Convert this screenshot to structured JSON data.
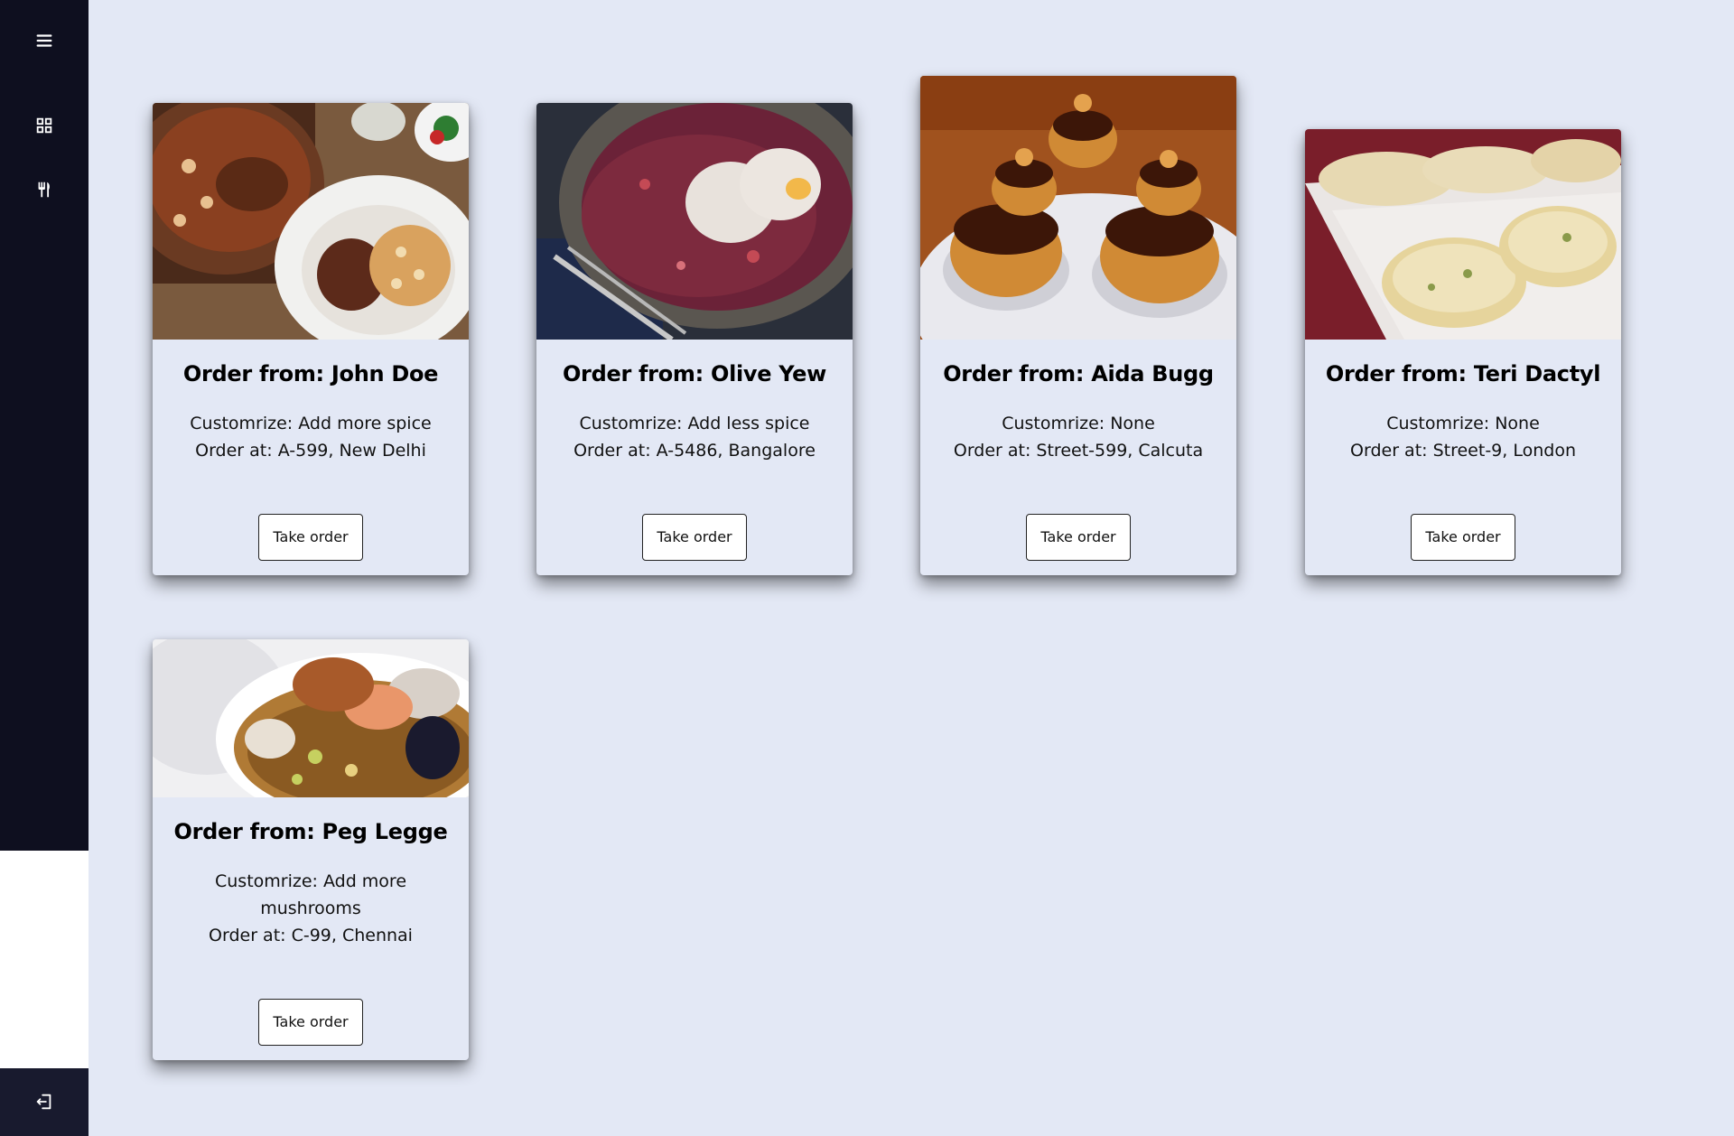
{
  "sidebar": {
    "menu_icon": "hamburger-menu-icon",
    "dashboard_icon": "grid-dashboard-icon",
    "orders_icon": "fork-knife-icon",
    "logout_icon": "logout-icon"
  },
  "orders": [
    {
      "title": "Order from: John Doe",
      "customize": "Customrize: Add more spice",
      "address": "Order at: A-599, New Delhi",
      "button": "Take order",
      "image": "dish-stew-beans"
    },
    {
      "title": "Order from: Olive Yew",
      "customize": "Customrize: Add less spice",
      "address": "Order at: A-5486, Bangalore",
      "button": "Take order",
      "image": "dish-poached-eggs"
    },
    {
      "title": "Order from: Aida Bugg",
      "customize": "Customrize: None",
      "address": "Order at: Street-599, Calcuta",
      "button": "Take order",
      "image": "dish-chocolate-pastries"
    },
    {
      "title": "Order from: Teri Dactyl",
      "customize": "Customrize: None",
      "address": "Order at: Street-9, London",
      "button": "Take order",
      "image": "dish-garlic-bread"
    },
    {
      "title": "Order from: Peg Legge",
      "customize": "Customrize: Add more mushrooms",
      "address": "Order at: C-99, Chennai",
      "button": "Take order",
      "image": "dish-seafood-soup"
    }
  ]
}
